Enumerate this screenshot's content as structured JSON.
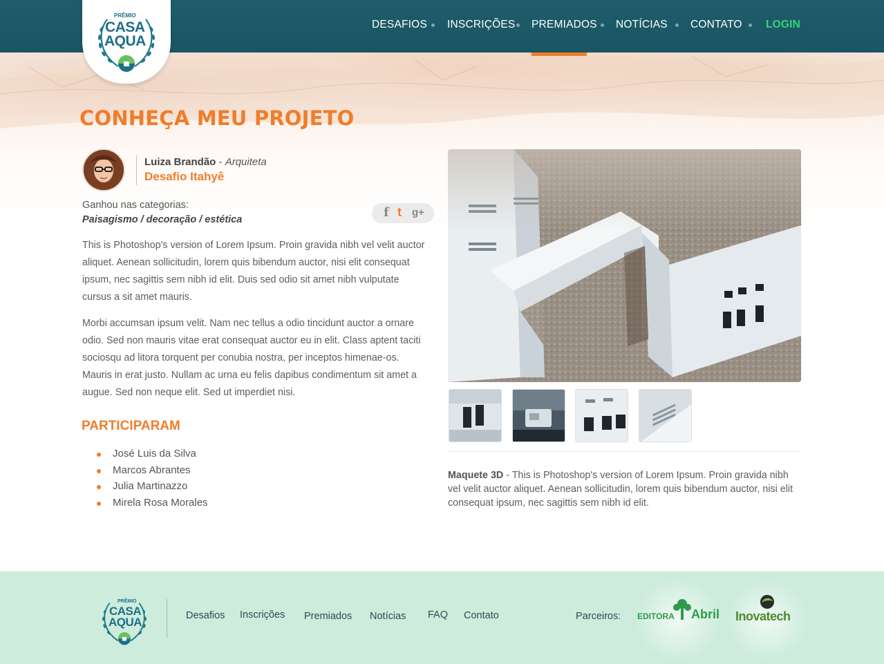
{
  "colors": {
    "accent_orange": "#f07d2a",
    "nav_teal": "#1f5d6a",
    "login_green": "#38d47c",
    "footer_mint": "#cdecdc"
  },
  "logo": {
    "small_text": "PRÊMIO",
    "line1": "CASA",
    "line2": "AQUA",
    "icon": "house-droplet-icon"
  },
  "nav": {
    "items": [
      "DESAFIOS",
      "INSCRIÇÕES",
      "PREMIADOS",
      "NOTÍCIAS",
      "CONTATO"
    ],
    "active": "PREMIADOS",
    "login": "LOGIN"
  },
  "page": {
    "title": "CONHEÇA MEU PROJETO"
  },
  "author": {
    "name": "Luiza Brandão",
    "separator": " - ",
    "role": "Arquiteta",
    "challenge": "Desafio Itahyê"
  },
  "categories": {
    "label": "Ganhou nas categorias:",
    "values": "Paisagismo / decoração / estética"
  },
  "share": {
    "facebook": "f",
    "twitter": "t",
    "googleplus": "g+"
  },
  "body": {
    "paragraph1": "This is Photoshop's version  of Lorem Ipsum. Proin gravida nibh vel velit auctor aliquet. Aenean sollicitudin, lorem quis bibendum auctor, nisi elit consequat ipsum, nec sagittis sem nibh id elit. Duis sed odio sit amet nibh vulputate cursus a sit amet mauris.",
    "paragraph2": "Morbi accumsan ipsum velit. Nam nec tellus a odio tincidunt auctor a ornare odio. Sed non  mauris vitae erat consequat auctor eu in elit. Class aptent taciti sociosqu ad litora torquent per conubia nostra, per inceptos himenae-os. Mauris in erat justo. Nullam ac urna eu felis dapibus condimentum sit amet a augue. Sed non neque elit. Sed ut imperdiet nisi."
  },
  "participants": {
    "title": "PARTICIPARAM",
    "names": [
      "José Luis da Silva",
      "Marcos Abrantes",
      "Julia Martinazzo",
      "Mirela Rosa Morales"
    ]
  },
  "gallery": {
    "thumbnail_count": 4,
    "caption_title": "Maquete 3D",
    "caption_separator": " - ",
    "caption_text": "This is Photoshop's version  of Lorem Ipsum. Proin gravida nibh vel velit auctor aliquet. Aenean sollicitudin, lorem quis bibendum auctor, nisi elit consequat ipsum, nec sagittis sem nibh id elit."
  },
  "footer": {
    "links": [
      "Desafios",
      "Inscrições",
      "Premiados",
      "Notícias",
      "FAQ",
      "Contato"
    ],
    "partners_label": "Parceiros:",
    "partner1_prefix": "EDITORA",
    "partner1_name": "Abril",
    "partner2_name": "Inovatech"
  }
}
